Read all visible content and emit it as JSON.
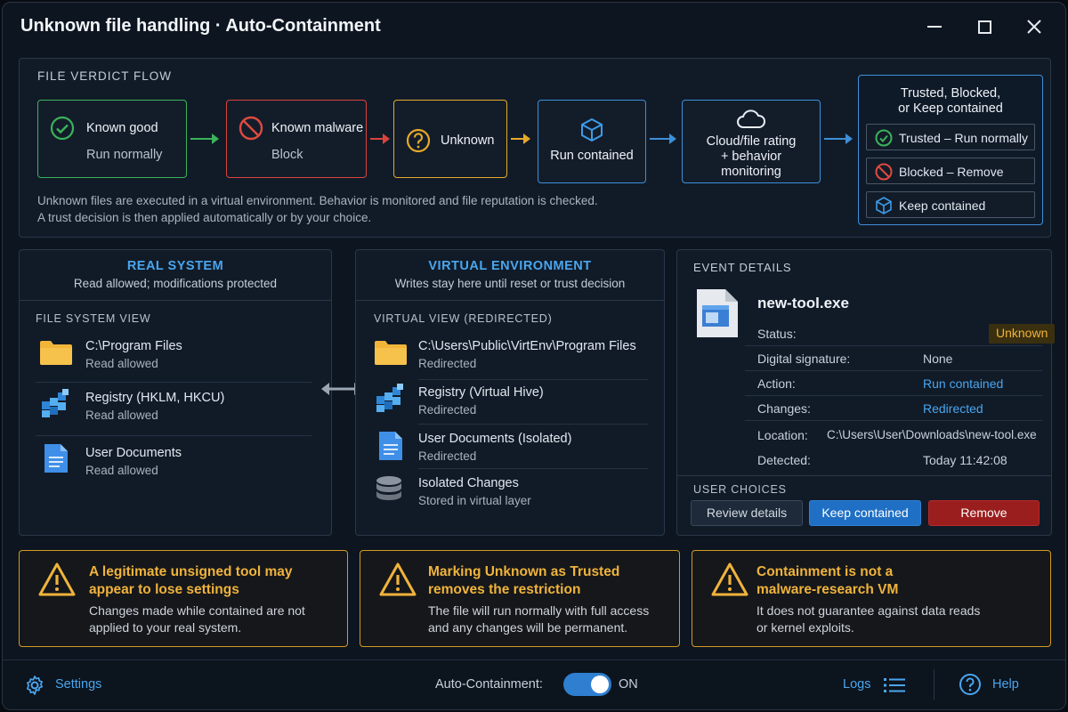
{
  "window": {
    "title": "Unknown file handling · Auto-Containment"
  },
  "flow": {
    "heading": "FILE VERDICT FLOW",
    "boxes": [
      {
        "label": "Known good",
        "sub": "Run normally",
        "color": "#3bb35a",
        "icon": "check-circle-icon"
      },
      {
        "label": "Known malware",
        "sub": "Block",
        "color": "#d9443c",
        "icon": "blocked-icon"
      },
      {
        "label": "Unknown",
        "color": "#e6a92a",
        "icon": "question-circle-icon"
      },
      {
        "label": "Run contained",
        "color": "#3d8fd8",
        "icon": "cube-icon"
      },
      {
        "line1": "Cloud/file rating",
        "line2": "+ behavior",
        "line3": "monitoring",
        "color": "#3d8fd8",
        "icon": "cloud-icon"
      }
    ],
    "description_line1": "Unknown files are executed in a virtual environment. Behavior is monitored and file reputation is checked.",
    "description_line2": "A trust decision is then applied automatically or by your choice.",
    "outcome": {
      "heading_line1": "Trusted, Blocked,",
      "heading_line2": "or Keep contained",
      "options": [
        "Trusted – Run normally",
        "Blocked – Remove",
        "Keep contained"
      ]
    }
  },
  "real_system": {
    "title": "REAL SYSTEM",
    "subtitle": "Read allowed; modifications protected",
    "view_label": "FILE SYSTEM VIEW",
    "items": [
      {
        "name": "C:\\Program Files",
        "status": "Read allowed",
        "icon": "folder-icon"
      },
      {
        "name": "Registry (HKLM, HKCU)",
        "status": "Read allowed",
        "icon": "registry-icon"
      },
      {
        "name": "User Documents",
        "status": "Read allowed",
        "icon": "document-icon"
      }
    ]
  },
  "virtual_env": {
    "title": "VIRTUAL ENVIRONMENT",
    "subtitle": "Writes stay here until reset or trust decision",
    "view_label": "VIRTUAL VIEW (REDIRECTED)",
    "items": [
      {
        "name": "C:\\Users\\Public\\VirtEnv\\Program Files",
        "status": "Redirected",
        "icon": "folder-icon"
      },
      {
        "name": "Registry (Virtual Hive)",
        "status": "Redirected",
        "icon": "registry-icon"
      },
      {
        "name": "User Documents (Isolated)",
        "status": "Redirected",
        "icon": "document-icon"
      },
      {
        "name": "Isolated Changes",
        "status": "Stored in virtual layer",
        "icon": "database-icon"
      }
    ]
  },
  "event": {
    "heading": "EVENT DETAILS",
    "file_name": "new-tool.exe",
    "fields": [
      {
        "key": "Status:",
        "value": "Unknown"
      },
      {
        "key": "Digital signature:",
        "value": "None"
      },
      {
        "key": "Action:",
        "value": "Run contained"
      },
      {
        "key": "Changes:",
        "value": "Redirected"
      },
      {
        "key": "Location:",
        "value": "C:\\Users\\User\\Downloads\\new-tool.exe"
      },
      {
        "key": "Detected:",
        "value": "Today 11:42:08"
      }
    ],
    "choices_label": "USER CHOICES",
    "buttons": {
      "review": "Review details",
      "keep": "Keep contained",
      "remove": "Remove"
    }
  },
  "warnings": [
    {
      "title_line1": "A legitimate unsigned tool may",
      "title_line2": "appear to lose settings",
      "desc_line1": "Changes made while contained are not",
      "desc_line2": "applied to your real system."
    },
    {
      "title_line1": "Marking Unknown as Trusted",
      "title_line2": "removes the restriction",
      "desc_line1": "The file will run normally with full access",
      "desc_line2": "and any changes will be permanent."
    },
    {
      "title_line1": "Containment is not a",
      "title_line2": "malware-research VM",
      "desc_line1": "It does not guarantee against data reads",
      "desc_line2": "or kernel exploits."
    }
  ],
  "footer": {
    "settings": "Settings",
    "auto_label": "Auto-Containment:",
    "toggle_state": "ON",
    "logs": "Logs",
    "help": "Help"
  },
  "colors": {
    "accent": "#3d8fd8",
    "good": "#3bb35a",
    "bad": "#d9443c",
    "warn": "#e6a92a"
  }
}
